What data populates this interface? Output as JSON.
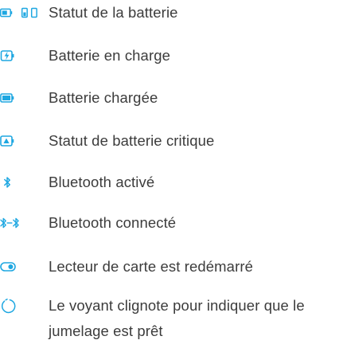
{
  "accent_color": "#1ea7e1",
  "items": [
    {
      "icon": "battery-status-icon",
      "label": "Statut de la batterie"
    },
    {
      "icon": "battery-charging-icon",
      "label": "Batterie en charge"
    },
    {
      "icon": "battery-charged-icon",
      "label": "Batterie chargée"
    },
    {
      "icon": "battery-critical-icon",
      "label": "Statut de batterie critique"
    },
    {
      "icon": "bluetooth-icon",
      "label": "Bluetooth activé"
    },
    {
      "icon": "bluetooth-connected-icon",
      "label": "Bluetooth connecté"
    },
    {
      "icon": "card-reader-icon",
      "label": "Lecteur de carte est redémarré"
    },
    {
      "icon": "pairing-blink-icon",
      "label": "Le voyant clignote pour indiquer que le jumelage est prêt"
    }
  ]
}
